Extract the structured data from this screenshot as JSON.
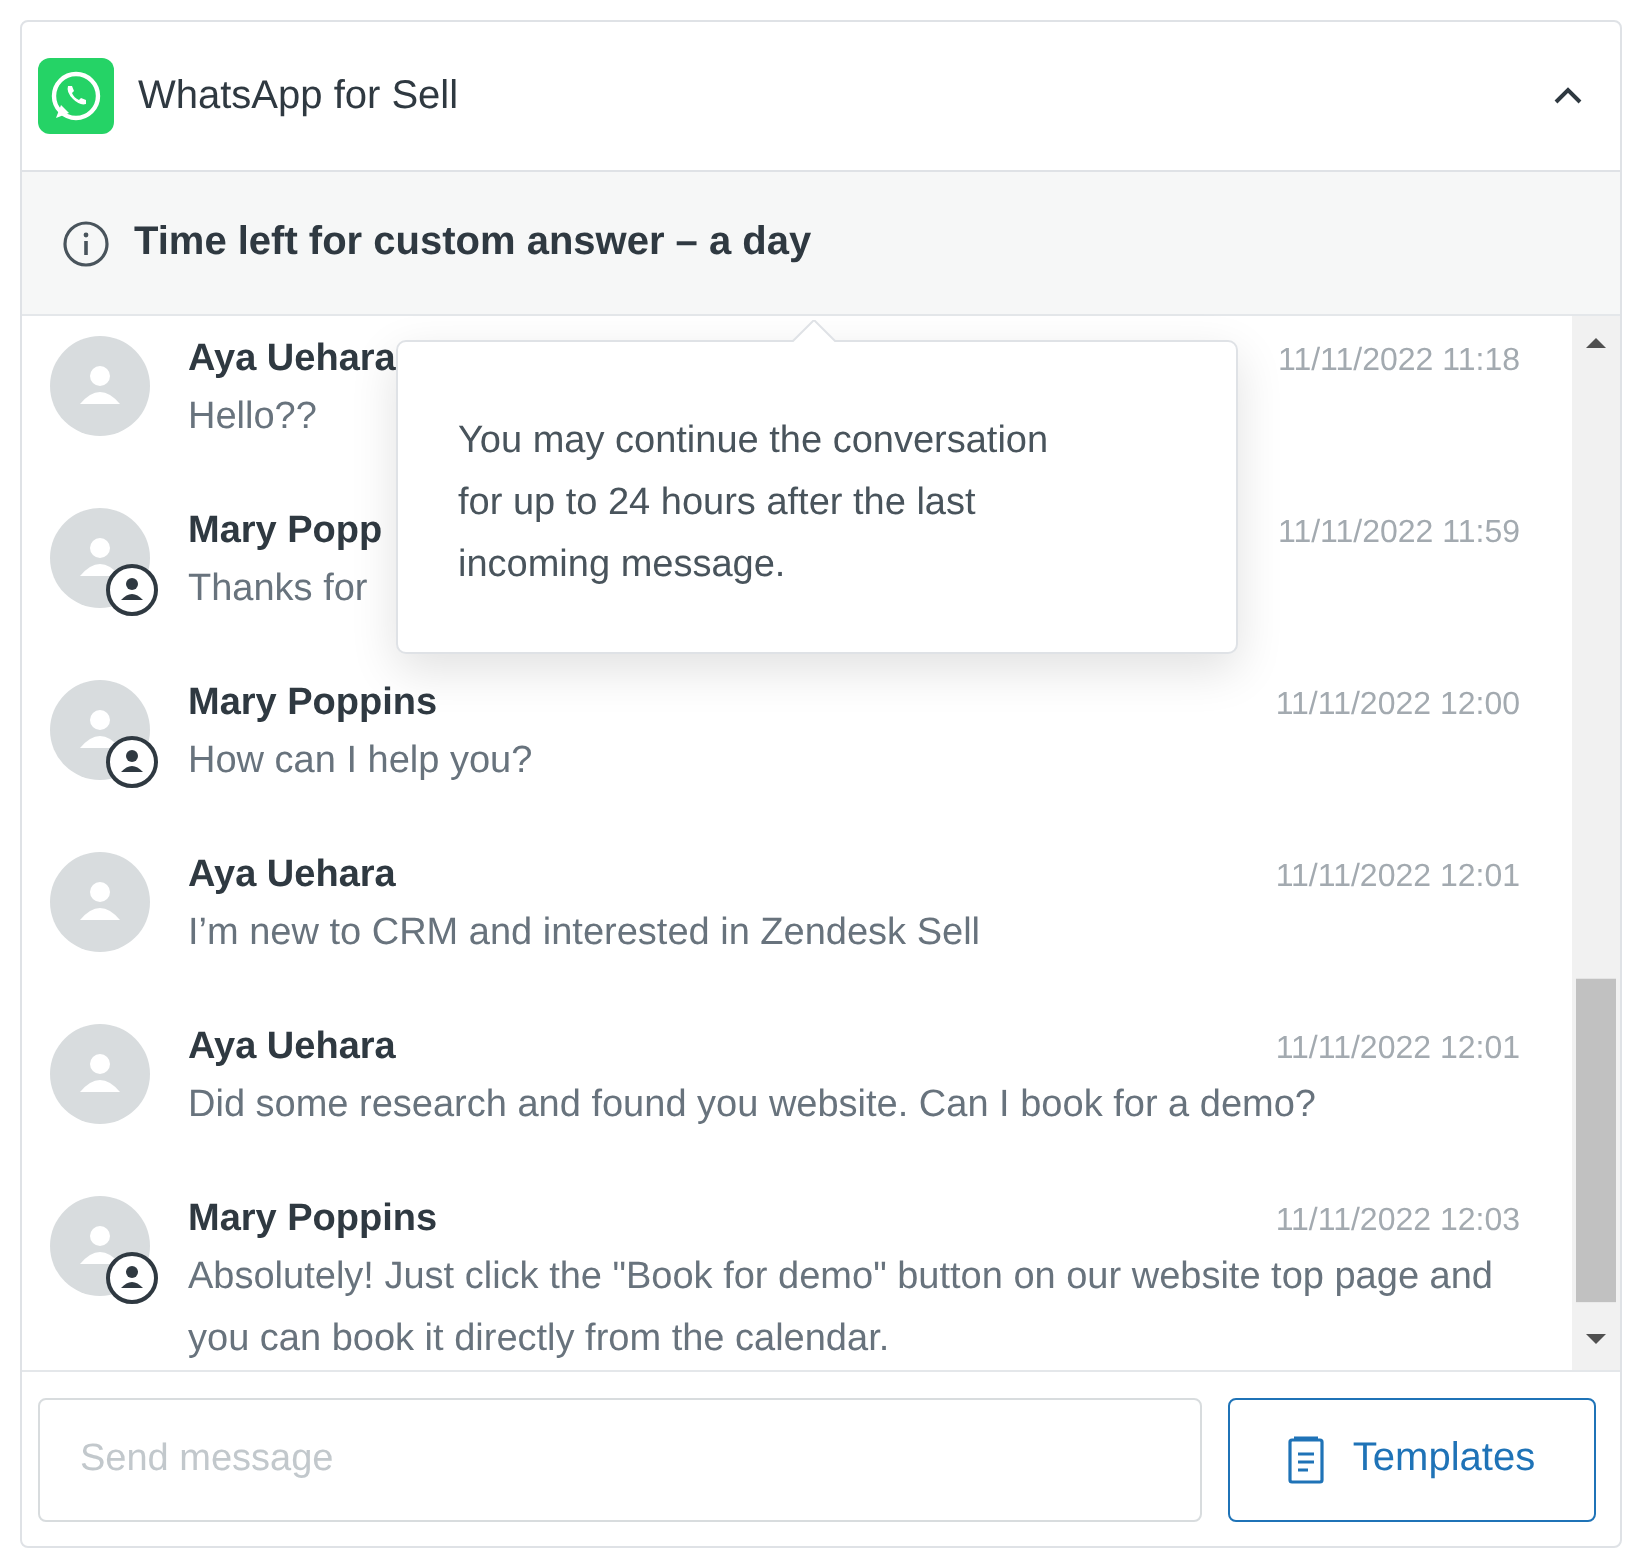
{
  "header": {
    "title": "WhatsApp for Sell",
    "expanded": true
  },
  "banner": {
    "text": "Time left for custom answer – a day"
  },
  "messages": [
    {
      "author": "Aya Uehara",
      "time": "11/11/2022 11:18",
      "text": "Hello??",
      "agent": false
    },
    {
      "author": "Mary Popp",
      "time": "11/11/2022 11:59",
      "text": "Thanks for",
      "agent": true
    },
    {
      "author": "Mary Poppins",
      "time": "11/11/2022 12:00",
      "text": "How can I help you?",
      "agent": true
    },
    {
      "author": "Aya Uehara",
      "time": "11/11/2022 12:01",
      "text": "I’m new to CRM and interested in Zendesk Sell",
      "agent": false
    },
    {
      "author": "Aya Uehara",
      "time": "11/11/2022 12:01",
      "text": "Did some research and found you website. Can I book for a demo?",
      "agent": false
    },
    {
      "author": "Mary Poppins",
      "time": "11/11/2022 12:03",
      "text": "Absolutely! Just click the \"Book for demo\" button on our website top page and you can book it directly from the calendar.",
      "agent": true
    }
  ],
  "tooltip": {
    "text": "You may continue the conversation for up to 24 hours after the last incoming message."
  },
  "composer": {
    "placeholder": "Send message",
    "button": "Templates"
  }
}
